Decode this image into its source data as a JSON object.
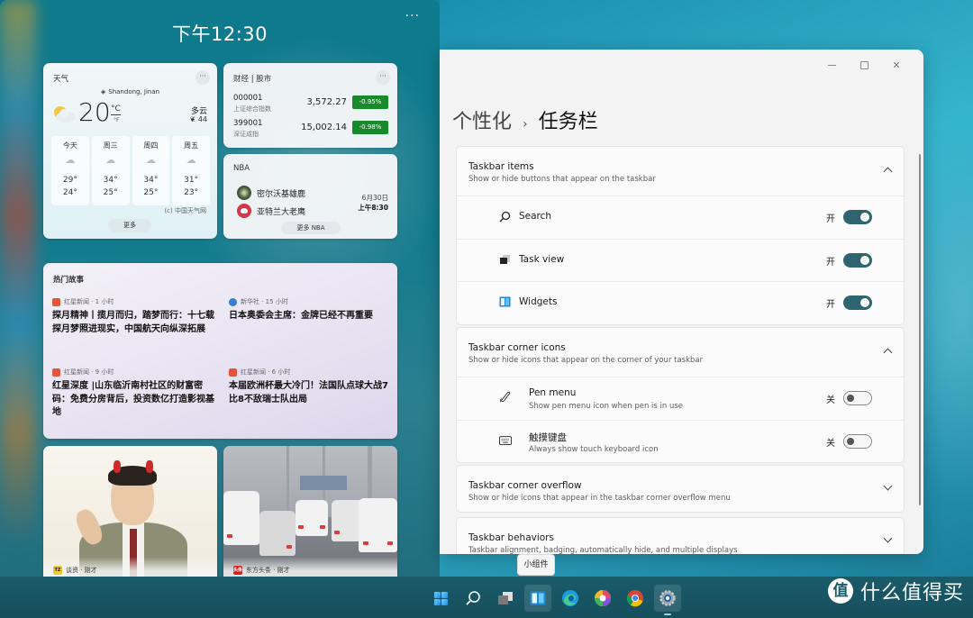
{
  "board": {
    "time": "下午12:30",
    "more": "···"
  },
  "weather": {
    "title": "天气",
    "location": "Shandong, Jinan",
    "temp": "20",
    "unit_c": "°C",
    "unit_f": "°F",
    "condition": "多云",
    "aqi": "44",
    "aqi_icon": "leaf-icon",
    "forecast": [
      {
        "day": "今天",
        "icon": "thunderstorm-icon",
        "high": "29°",
        "low": "24°"
      },
      {
        "day": "周三",
        "icon": "thunderstorm-icon",
        "high": "34°",
        "low": "25°"
      },
      {
        "day": "周四",
        "icon": "cloudy-icon",
        "high": "34°",
        "low": "25°"
      },
      {
        "day": "周五",
        "icon": "cloudy-icon",
        "high": "31°",
        "low": "23°"
      }
    ],
    "source": "(c) 中国天气网",
    "more": "更多"
  },
  "stocks": {
    "title": "财经 | 股市",
    "items": [
      {
        "code": "000001",
        "name": "上证综合指数",
        "value": "3,572.27",
        "change": "-0.95%"
      },
      {
        "code": "399001",
        "name": "深证成指",
        "value": "15,002.14",
        "change": "-0.98%"
      }
    ],
    "change_color": "#178a2b"
  },
  "nba": {
    "title": "NBA",
    "home": "密尔沃基雄鹿",
    "away": "亚特兰大老鹰",
    "date": "6月30日",
    "time": "上午8:30",
    "more": "更多 NBA"
  },
  "stories": {
    "title": "热门故事",
    "items": [
      {
        "source": "红星新闻 · 1 小时",
        "headline": "探月精神丨揽月而归，踏梦而行：十七载探月梦照进现实，中国航天向纵深拓展"
      },
      {
        "source": "新华社 · 15 小时",
        "headline": "日本奥委会主席：金牌已经不再重要"
      },
      {
        "source": "红星新闻 · 9 小时",
        "headline": "红星深度 |山东临沂南村社区的财富密码：免费分房背后，投资数亿打造影视基地"
      },
      {
        "source": "红星新闻 · 6 小时",
        "headline": "本届欧洲杯最大冷门！法国队点球大战7比8不敌瑞士队出局"
      }
    ]
  },
  "photos": [
    {
      "source": "谈资 · 刚才",
      "badge": "TZ"
    },
    {
      "source": "东方头条 · 刚才",
      "badge": "头条"
    }
  ],
  "settings": {
    "breadcrumb_parent": "个性化",
    "breadcrumb_sep": "›",
    "breadcrumb_current": "任务栏",
    "accent": "#2f6571",
    "groups": [
      {
        "title": "Taskbar items",
        "subtitle": "Show or hide buttons that appear on the taskbar",
        "expanded": true,
        "rows": [
          {
            "label": "Search",
            "icon": "search-icon",
            "state": "开",
            "on": true
          },
          {
            "label": "Task view",
            "icon": "task-view-icon",
            "state": "开",
            "on": true
          },
          {
            "label": "Widgets",
            "icon": "widgets-icon",
            "state": "开",
            "on": true
          }
        ]
      },
      {
        "title": "Taskbar corner icons",
        "subtitle": "Show or hide icons that appear on the corner of your taskbar",
        "expanded": true,
        "rows": [
          {
            "label": "Pen menu",
            "sub": "Show pen menu icon when pen is in use",
            "icon": "pen-icon",
            "state": "关",
            "on": false
          },
          {
            "label": "触摸键盘",
            "sub": "Always show touch keyboard icon",
            "icon": "keyboard-icon",
            "state": "关",
            "on": false
          }
        ]
      },
      {
        "title": "Taskbar corner overflow",
        "subtitle": "Show or hide icons that appear in the taskbar corner overflow menu",
        "expanded": false
      },
      {
        "title": "Taskbar behaviors",
        "subtitle": "Taskbar alignment, badging, automatically hide, and multiple displays",
        "expanded": false
      }
    ]
  },
  "tooltip": "小组件",
  "taskbar": {
    "apps": [
      "start",
      "search",
      "task-view",
      "widgets",
      "edge",
      "photos",
      "chrome",
      "settings"
    ]
  },
  "watermark": {
    "badge": "值",
    "text": "什么值得买"
  }
}
